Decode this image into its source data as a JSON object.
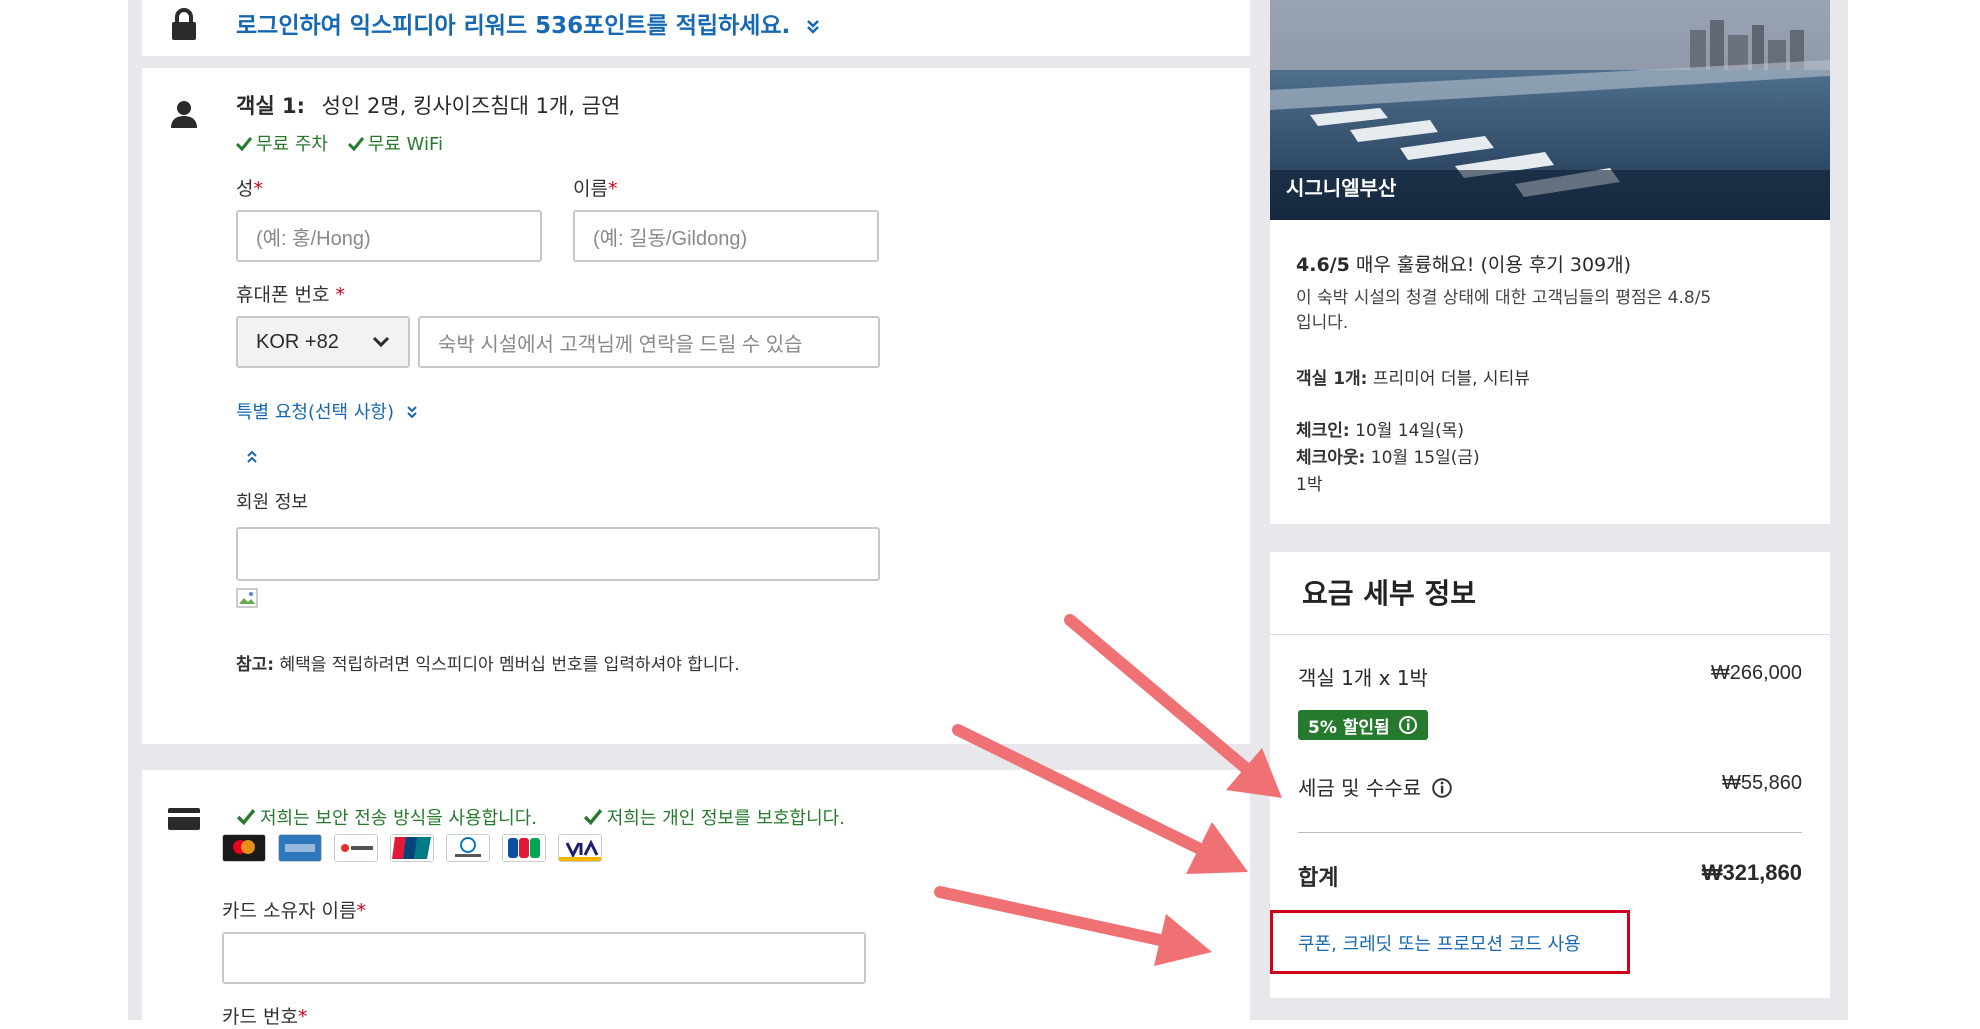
{
  "login_banner": {
    "text": "로그인하여 익스피디아 리워드 536포인트를 적립하세요."
  },
  "room": {
    "label": "객실 1:",
    "summary": "성인 2명, 킹사이즈침대 1개, 금연",
    "amenities": [
      "무료 주차",
      "무료 WiFi"
    ]
  },
  "guest_form": {
    "last_name_label": "성",
    "last_name_placeholder": "(예: 홍/Hong)",
    "first_name_label": "이름",
    "first_name_placeholder": "(예: 길동/Gildong)",
    "required_mark": "*",
    "phone_label": "휴대폰 번호",
    "country_code": "KOR +82",
    "phone_placeholder": "숙박 시설에서 고객님께 연락을 드릴 수 있습",
    "special_request": "특별 요청(선택 사항)",
    "member_label": "회원 정보",
    "member_value": "",
    "note_label": "참고:",
    "note_text": "혜택을 적립하려면 익스피디아 멤버십 번호를 입력하셔야 합니다."
  },
  "payment": {
    "secure1": "저희는 보안 전송 방식을 사용합니다.",
    "secure2": "저희는 개인 정보를 보호합니다.",
    "card_brands": [
      "MasterCard",
      "AMERICAN EXPRESS",
      "비씨카드",
      "UnionPay 银联",
      "Diners Club",
      "JCB",
      "VISA"
    ],
    "cardholder_label": "카드 소유자 이름",
    "cardholder_value": "",
    "card_number_label": "카드 번호"
  },
  "hotel": {
    "name": "시그니엘부산",
    "rating": "4.6/5",
    "rating_text": "매우 훌륭해요! (이용 후기 309개)",
    "clean_text_1": "이 숙박 시설의 청결 상태에 대한 고객님들의 평점은 4.8/5",
    "clean_text_2": "입니다.",
    "room_label": "객실 1개:",
    "room_type": "프리미어 더블, 시티뷰",
    "checkin_label": "체크인:",
    "checkin": "10월 14일(목)",
    "checkout_label": "체크아웃:",
    "checkout": "10월 15일(금)",
    "nights": "1박"
  },
  "price_details": {
    "title": "요금 세부 정보",
    "room_line": "객실 1개 x 1박",
    "room_price": "₩266,000",
    "discount_badge": "5% 할인됨",
    "tax_label": "세금 및 수수료",
    "tax_price": "₩55,860",
    "total_label": "합계",
    "total_price": "₩321,860",
    "coupon_link": "쿠폰, 크레딧 또는 프로모션 코드 사용"
  },
  "colors": {
    "link": "#1668b3",
    "success": "#257a2e",
    "badge_bg": "#257a2e",
    "highlight_box": "#d0021b",
    "annotation_arrow": "#f07173"
  },
  "icons": [
    "lock-icon",
    "user-icon",
    "check-icon",
    "credit-card-icon",
    "info-icon",
    "chevron-down-icon",
    "double-chevron-down-icon",
    "double-chevron-up-icon",
    "broken-image-icon"
  ]
}
